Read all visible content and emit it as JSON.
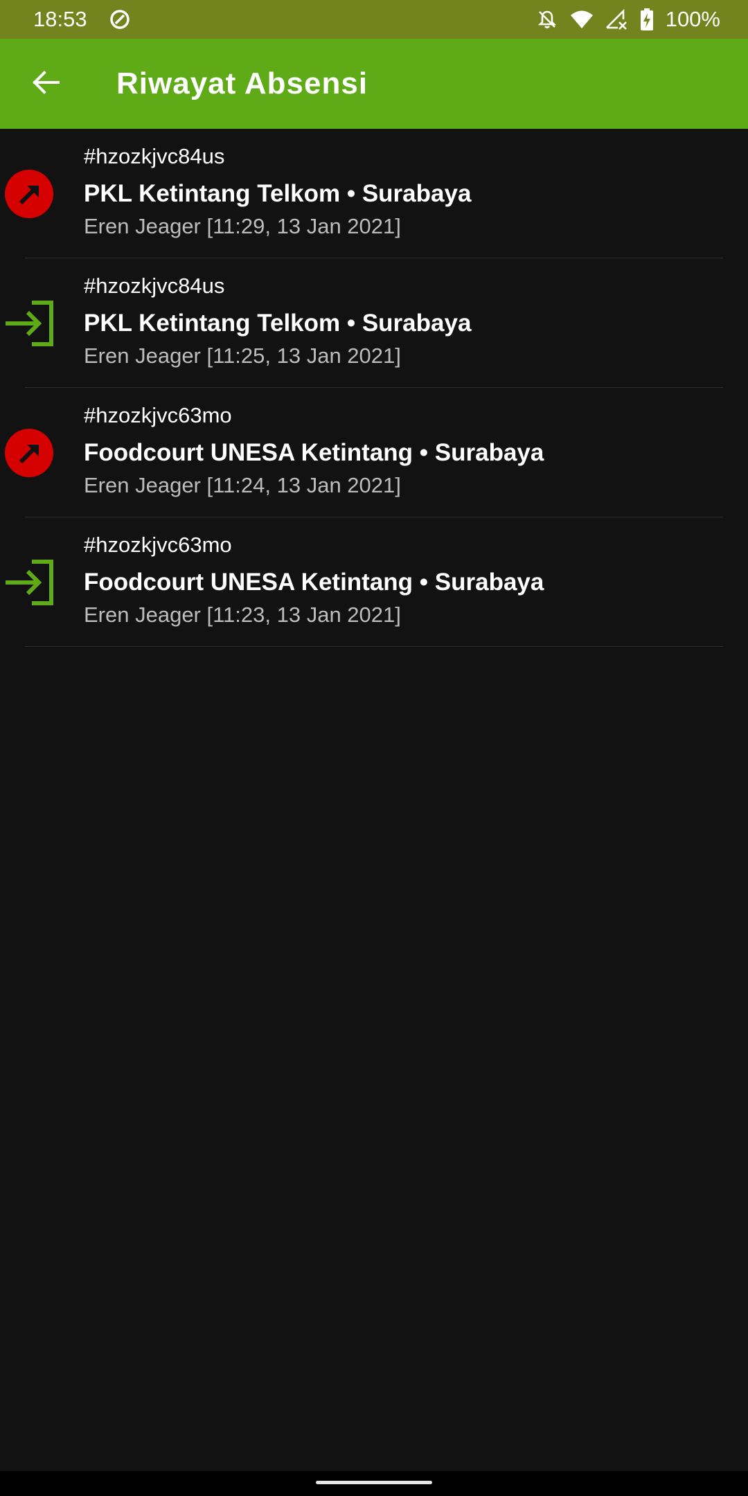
{
  "status_bar": {
    "time": "18:53",
    "battery": "100%",
    "icons": [
      "data-saver-icon",
      "notifications-off-icon",
      "wifi-icon",
      "cellular-no-data-icon",
      "battery-charging-icon"
    ]
  },
  "app_bar": {
    "title": "Riwayat Absensi",
    "back_icon": "arrow-back-icon",
    "background": "#5faa17"
  },
  "colors": {
    "check_out": "#d50000",
    "check_in": "#5faa17"
  },
  "records": [
    {
      "type": "check-out",
      "icon": "check-out-arrow-icon",
      "code": "#hzozkjvc84us",
      "place": "PKL Ketintang Telkom • Surabaya",
      "meta": "Eren Jeager [11:29, 13 Jan 2021]"
    },
    {
      "type": "check-in",
      "icon": "login-icon",
      "code": "#hzozkjvc84us",
      "place": "PKL Ketintang Telkom • Surabaya",
      "meta": "Eren Jeager [11:25, 13 Jan 2021]"
    },
    {
      "type": "check-out",
      "icon": "check-out-arrow-icon",
      "code": "#hzozkjvc63mo",
      "place": "Foodcourt UNESA Ketintang • Surabaya",
      "meta": "Eren Jeager [11:24, 13 Jan 2021]"
    },
    {
      "type": "check-in",
      "icon": "login-icon",
      "code": "#hzozkjvc63mo",
      "place": "Foodcourt UNESA Ketintang • Surabaya",
      "meta": "Eren Jeager [11:23, 13 Jan 2021]"
    }
  ]
}
